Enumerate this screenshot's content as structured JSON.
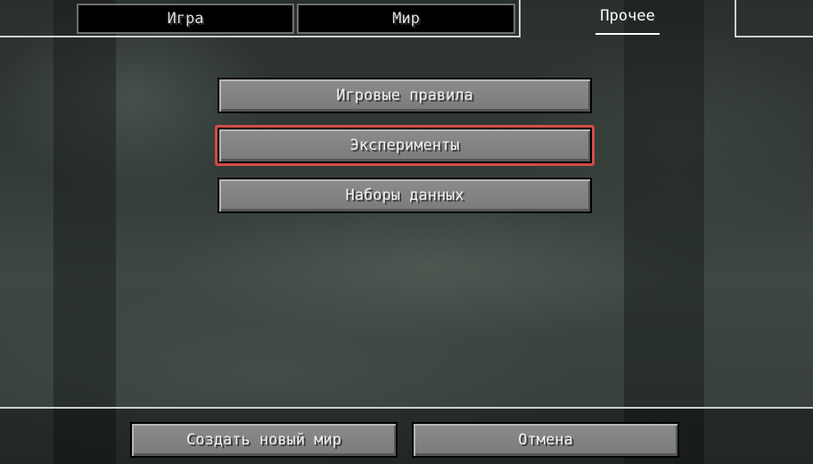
{
  "tabs": [
    {
      "label": "Игра",
      "active": false
    },
    {
      "label": "Мир",
      "active": false
    },
    {
      "label": "Прочее",
      "active": true
    }
  ],
  "options": {
    "game_rules_label": "Игровые правила",
    "experiments_label": "Эксперименты",
    "data_packs_label": "Наборы данных"
  },
  "footer": {
    "create_label": "Создать новый мир",
    "cancel_label": "Отмена"
  },
  "colors": {
    "highlight": "#d24c47",
    "button_face": "#828282",
    "tab_bg": "#000000"
  }
}
